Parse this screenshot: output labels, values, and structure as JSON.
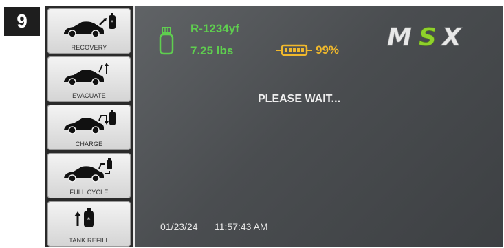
{
  "step_number": "9",
  "sidebar": {
    "items": [
      {
        "label": "RECOVERY",
        "icon": "recovery-icon"
      },
      {
        "label": "EVACUATE",
        "icon": "evacuate-icon"
      },
      {
        "label": "CHARGE",
        "icon": "charge-icon"
      },
      {
        "label": "FULL CYCLE",
        "icon": "full-cycle-icon"
      },
      {
        "label": "TANK REFILL",
        "icon": "tank-refill-icon"
      }
    ]
  },
  "status_bar": {
    "refrigerant": "R-1234yf",
    "weight": "7.25 lbs",
    "battery_level": "99%",
    "brand": "MSX"
  },
  "main": {
    "status_message": "PLEASE WAIT..."
  },
  "footer": {
    "date": "01/23/24",
    "time": "11:57:43 AM"
  },
  "colors": {
    "accent_green": "#5fce4f",
    "battery_yellow": "#f0b82c",
    "logo_green": "#8fd12b",
    "screen_gray": "#4a4d50"
  }
}
